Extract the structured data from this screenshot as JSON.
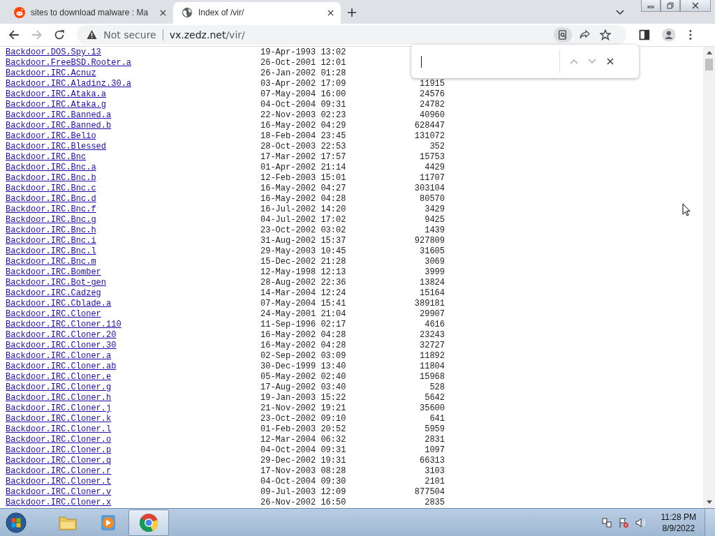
{
  "tabs": [
    {
      "title": "sites to download malware : Ma",
      "selected": false
    },
    {
      "title": "Index of /vir/",
      "selected": true
    }
  ],
  "address_bar": {
    "security": "Not secure",
    "host": "vx.zedz.net",
    "path": "/vir/"
  },
  "listing": [
    {
      "name": "Backdoor.DOS.Spy.13",
      "date": "19-Apr-1993 13:02"
    },
    {
      "name": "Backdoor.FreeBSD.Rooter.a",
      "date": "26-Oct-2001 12:01"
    },
    {
      "name": "Backdoor.IRC.Acnuz",
      "date": "26-Jan-2002 01:28"
    },
    {
      "name": "Backdoor.IRC.Aladinz.30.a",
      "date": "03-Apr-2002 17:09",
      "size": "11915"
    },
    {
      "name": "Backdoor.IRC.Ataka.a",
      "date": "07-May-2004 16:00",
      "size": "24576"
    },
    {
      "name": "Backdoor.IRC.Ataka.g",
      "date": "04-Oct-2004 09:31",
      "size": "24782"
    },
    {
      "name": "Backdoor.IRC.Banned.a",
      "date": "22-Nov-2003 02:23",
      "size": "40960"
    },
    {
      "name": "Backdoor.IRC.Banned.b",
      "date": "16-May-2002 04:29",
      "size": "628447"
    },
    {
      "name": "Backdoor.IRC.Belio",
      "date": "18-Feb-2004 23:45",
      "size": "131072"
    },
    {
      "name": "Backdoor.IRC.Blessed",
      "date": "28-Oct-2003 22:53",
      "size": "352"
    },
    {
      "name": "Backdoor.IRC.Bnc",
      "date": "17-Mar-2002 17:57",
      "size": "15753"
    },
    {
      "name": "Backdoor.IRC.Bnc.a",
      "date": "01-Apr-2002 21:14",
      "size": "4429"
    },
    {
      "name": "Backdoor.IRC.Bnc.b",
      "date": "12-Feb-2003 15:01",
      "size": "11707"
    },
    {
      "name": "Backdoor.IRC.Bnc.c",
      "date": "16-May-2002 04:27",
      "size": "303104"
    },
    {
      "name": "Backdoor.IRC.Bnc.d",
      "date": "16-May-2002 04:28",
      "size": "80570"
    },
    {
      "name": "Backdoor.IRC.Bnc.f",
      "date": "16-Jul-2002 14:20",
      "size": "3429"
    },
    {
      "name": "Backdoor.IRC.Bnc.g",
      "date": "04-Jul-2002 17:02",
      "size": "9425"
    },
    {
      "name": "Backdoor.IRC.Bnc.h",
      "date": "23-Oct-2002 03:02",
      "size": "1439"
    },
    {
      "name": "Backdoor.IRC.Bnc.i",
      "date": "31-Aug-2002 15:37",
      "size": "927809"
    },
    {
      "name": "Backdoor.IRC.Bnc.l",
      "date": "29-May-2003 10:45",
      "size": "31605"
    },
    {
      "name": "Backdoor.IRC.Bnc.m",
      "date": "15-Dec-2002 21:28",
      "size": "3069"
    },
    {
      "name": "Backdoor.IRC.Bomber",
      "date": "12-May-1998 12:13",
      "size": "3999"
    },
    {
      "name": "Backdoor.IRC.Bot-gen",
      "date": "28-Aug-2002 22:36",
      "size": "13824"
    },
    {
      "name": "Backdoor.IRC.Cadzeg",
      "date": "14-Mar-2004 12:24",
      "size": "15164"
    },
    {
      "name": "Backdoor.IRC.Cblade.a",
      "date": "07-May-2004 15:41",
      "size": "389181"
    },
    {
      "name": "Backdoor.IRC.Cloner",
      "date": "24-May-2001 21:04",
      "size": "29907"
    },
    {
      "name": "Backdoor.IRC.Cloner.110",
      "date": "11-Sep-1996 02:17",
      "size": "4616"
    },
    {
      "name": "Backdoor.IRC.Cloner.20",
      "date": "16-May-2002 04:28",
      "size": "23243"
    },
    {
      "name": "Backdoor.IRC.Cloner.30",
      "date": "16-May-2002 04:28",
      "size": "32727"
    },
    {
      "name": "Backdoor.IRC.Cloner.a",
      "date": "02-Sep-2002 03:09",
      "size": "11892"
    },
    {
      "name": "Backdoor.IRC.Cloner.ab",
      "date": "30-Dec-1999 13:40",
      "size": "11804"
    },
    {
      "name": "Backdoor.IRC.Cloner.e",
      "date": "05-May-2002 02:40",
      "size": "15968"
    },
    {
      "name": "Backdoor.IRC.Cloner.g",
      "date": "17-Aug-2002 03:40",
      "size": "528"
    },
    {
      "name": "Backdoor.IRC.Cloner.h",
      "date": "19-Jan-2003 15:22",
      "size": "5642"
    },
    {
      "name": "Backdoor.IRC.Cloner.j",
      "date": "21-Nov-2002 19:21",
      "size": "35600"
    },
    {
      "name": "Backdoor.IRC.Cloner.k",
      "date": "23-Oct-2002 09:10",
      "size": "641"
    },
    {
      "name": "Backdoor.IRC.Cloner.l",
      "date": "01-Feb-2003 20:52",
      "size": "5959"
    },
    {
      "name": "Backdoor.IRC.Cloner.o",
      "date": "12-Mar-2004 06:32",
      "size": "2831"
    },
    {
      "name": "Backdoor.IRC.Cloner.p",
      "date": "04-Oct-2004 09:31",
      "size": "1097"
    },
    {
      "name": "Backdoor.IRC.Cloner.q",
      "date": "29-Dec-2002 19:31",
      "size": "66313"
    },
    {
      "name": "Backdoor.IRC.Cloner.r",
      "date": "17-Nov-2003 08:28",
      "size": "3103"
    },
    {
      "name": "Backdoor.IRC.Cloner.t",
      "date": "04-Oct-2004 09:30",
      "size": "2101"
    },
    {
      "name": "Backdoor.IRC.Cloner.v",
      "date": "09-Jul-2003 12:09",
      "size": "877504"
    },
    {
      "name": "Backdoor.IRC.Cloner.x",
      "date": "26-Nov-2002 16:50",
      "size": "2835"
    }
  ],
  "taskbar": {
    "apps": [
      {
        "kind": "explorer",
        "selected": false
      },
      {
        "kind": "media",
        "selected": false
      },
      {
        "kind": "chrome",
        "selected": true
      }
    ],
    "time": "11:28 PM",
    "date": "8/9/2022"
  }
}
